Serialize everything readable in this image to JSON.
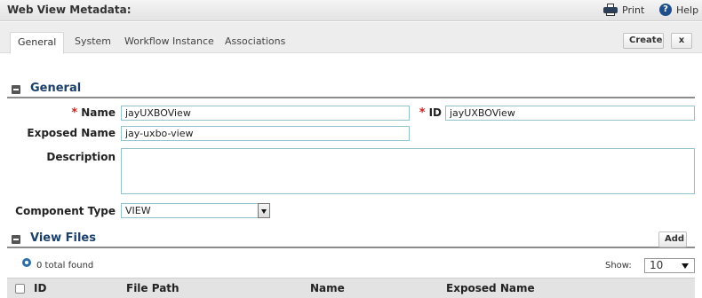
{
  "window": {
    "title": "Web View Metadata:",
    "print_label": "Print",
    "help_label": "Help"
  },
  "tabs": [
    "General",
    "System",
    "Workflow Instance",
    "Associations"
  ],
  "actions": {
    "create_label": "Create",
    "close_label": "x"
  },
  "general_section": {
    "title": "General",
    "required_marker": "*",
    "name": {
      "label": "Name",
      "value": "jayUXBOView"
    },
    "id": {
      "label": "ID",
      "value": "jayUXBOView"
    },
    "exposed_name": {
      "label": "Exposed Name",
      "value": "jay-uxbo-view"
    },
    "description": {
      "label": "Description",
      "value": ""
    },
    "component_type": {
      "label": "Component Type",
      "value": "VIEW"
    }
  },
  "view_files": {
    "title": "View Files",
    "add_label": "Add",
    "total_text": "0 total found",
    "show_label": "Show:",
    "page_size": "10",
    "columns": [
      "ID",
      "File Path",
      "Name",
      "Exposed Name"
    ]
  },
  "colors": {
    "accent": "#1b3f6b",
    "required": "#d02020",
    "input_border": "#8fc4ce"
  }
}
